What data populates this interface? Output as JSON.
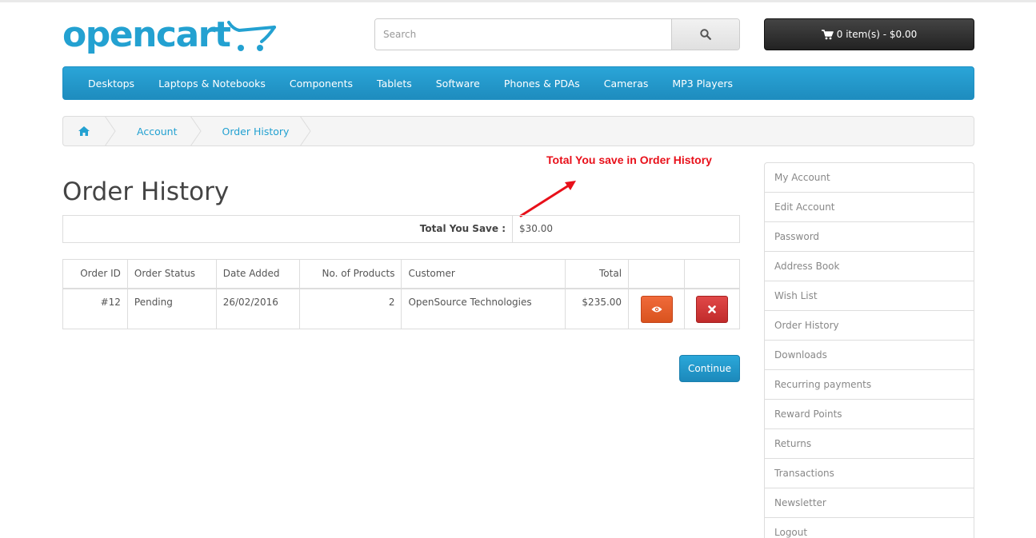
{
  "brand": {
    "logo_text": "opencart"
  },
  "search": {
    "placeholder": "Search"
  },
  "cart": {
    "label": "0 item(s) - $0.00"
  },
  "menu": {
    "items": [
      "Desktops",
      "Laptops & Notebooks",
      "Components",
      "Tablets",
      "Software",
      "Phones & PDAs",
      "Cameras",
      "MP3 Players"
    ]
  },
  "breadcrumb": {
    "items": [
      "Account",
      "Order History"
    ]
  },
  "annotation": {
    "text": "Total You save in Order History",
    "color": "#e8101a"
  },
  "page": {
    "title": "Order History"
  },
  "savings": {
    "label": "Total You Save :",
    "value": "$30.00"
  },
  "orders": {
    "headers": [
      "Order ID",
      "Order Status",
      "Date Added",
      "No. of Products",
      "Customer",
      "Total"
    ],
    "rows": [
      {
        "order_id": "#12",
        "status": "Pending",
        "date_added": "26/02/2016",
        "products": "2",
        "customer": "OpenSource Technologies",
        "total": "$235.00"
      }
    ]
  },
  "actions": {
    "continue_label": "Continue"
  },
  "sidebar": {
    "items": [
      "My Account",
      "Edit Account",
      "Password",
      "Address Book",
      "Wish List",
      "Order History",
      "Downloads",
      "Recurring payments",
      "Reward Points",
      "Returns",
      "Transactions",
      "Newsletter",
      "Logout"
    ]
  },
  "colors": {
    "accent": "#23a1d1",
    "view_button": "#e05a28",
    "delete_button": "#d13a3a"
  }
}
